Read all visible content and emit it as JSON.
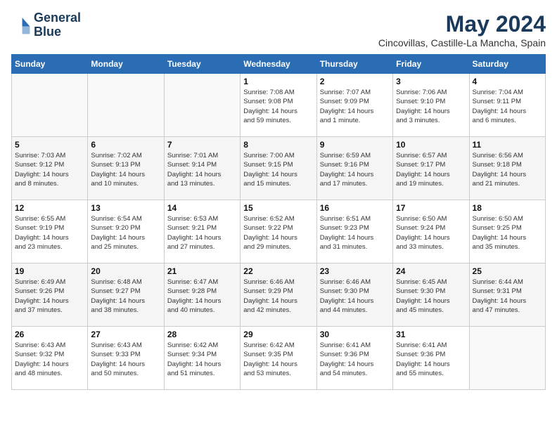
{
  "logo": {
    "line1": "General",
    "line2": "Blue"
  },
  "title": "May 2024",
  "location": "Cincovillas, Castille-La Mancha, Spain",
  "days_of_week": [
    "Sunday",
    "Monday",
    "Tuesday",
    "Wednesday",
    "Thursday",
    "Friday",
    "Saturday"
  ],
  "weeks": [
    [
      {
        "day": "",
        "info": ""
      },
      {
        "day": "",
        "info": ""
      },
      {
        "day": "",
        "info": ""
      },
      {
        "day": "1",
        "info": "Sunrise: 7:08 AM\nSunset: 9:08 PM\nDaylight: 14 hours\nand 59 minutes."
      },
      {
        "day": "2",
        "info": "Sunrise: 7:07 AM\nSunset: 9:09 PM\nDaylight: 14 hours\nand 1 minute."
      },
      {
        "day": "3",
        "info": "Sunrise: 7:06 AM\nSunset: 9:10 PM\nDaylight: 14 hours\nand 3 minutes."
      },
      {
        "day": "4",
        "info": "Sunrise: 7:04 AM\nSunset: 9:11 PM\nDaylight: 14 hours\nand 6 minutes."
      }
    ],
    [
      {
        "day": "5",
        "info": "Sunrise: 7:03 AM\nSunset: 9:12 PM\nDaylight: 14 hours\nand 8 minutes."
      },
      {
        "day": "6",
        "info": "Sunrise: 7:02 AM\nSunset: 9:13 PM\nDaylight: 14 hours\nand 10 minutes."
      },
      {
        "day": "7",
        "info": "Sunrise: 7:01 AM\nSunset: 9:14 PM\nDaylight: 14 hours\nand 13 minutes."
      },
      {
        "day": "8",
        "info": "Sunrise: 7:00 AM\nSunset: 9:15 PM\nDaylight: 14 hours\nand 15 minutes."
      },
      {
        "day": "9",
        "info": "Sunrise: 6:59 AM\nSunset: 9:16 PM\nDaylight: 14 hours\nand 17 minutes."
      },
      {
        "day": "10",
        "info": "Sunrise: 6:57 AM\nSunset: 9:17 PM\nDaylight: 14 hours\nand 19 minutes."
      },
      {
        "day": "11",
        "info": "Sunrise: 6:56 AM\nSunset: 9:18 PM\nDaylight: 14 hours\nand 21 minutes."
      }
    ],
    [
      {
        "day": "12",
        "info": "Sunrise: 6:55 AM\nSunset: 9:19 PM\nDaylight: 14 hours\nand 23 minutes."
      },
      {
        "day": "13",
        "info": "Sunrise: 6:54 AM\nSunset: 9:20 PM\nDaylight: 14 hours\nand 25 minutes."
      },
      {
        "day": "14",
        "info": "Sunrise: 6:53 AM\nSunset: 9:21 PM\nDaylight: 14 hours\nand 27 minutes."
      },
      {
        "day": "15",
        "info": "Sunrise: 6:52 AM\nSunset: 9:22 PM\nDaylight: 14 hours\nand 29 minutes."
      },
      {
        "day": "16",
        "info": "Sunrise: 6:51 AM\nSunset: 9:23 PM\nDaylight: 14 hours\nand 31 minutes."
      },
      {
        "day": "17",
        "info": "Sunrise: 6:50 AM\nSunset: 9:24 PM\nDaylight: 14 hours\nand 33 minutes."
      },
      {
        "day": "18",
        "info": "Sunrise: 6:50 AM\nSunset: 9:25 PM\nDaylight: 14 hours\nand 35 minutes."
      }
    ],
    [
      {
        "day": "19",
        "info": "Sunrise: 6:49 AM\nSunset: 9:26 PM\nDaylight: 14 hours\nand 37 minutes."
      },
      {
        "day": "20",
        "info": "Sunrise: 6:48 AM\nSunset: 9:27 PM\nDaylight: 14 hours\nand 38 minutes."
      },
      {
        "day": "21",
        "info": "Sunrise: 6:47 AM\nSunset: 9:28 PM\nDaylight: 14 hours\nand 40 minutes."
      },
      {
        "day": "22",
        "info": "Sunrise: 6:46 AM\nSunset: 9:29 PM\nDaylight: 14 hours\nand 42 minutes."
      },
      {
        "day": "23",
        "info": "Sunrise: 6:46 AM\nSunset: 9:30 PM\nDaylight: 14 hours\nand 44 minutes."
      },
      {
        "day": "24",
        "info": "Sunrise: 6:45 AM\nSunset: 9:30 PM\nDaylight: 14 hours\nand 45 minutes."
      },
      {
        "day": "25",
        "info": "Sunrise: 6:44 AM\nSunset: 9:31 PM\nDaylight: 14 hours\nand 47 minutes."
      }
    ],
    [
      {
        "day": "26",
        "info": "Sunrise: 6:43 AM\nSunset: 9:32 PM\nDaylight: 14 hours\nand 48 minutes."
      },
      {
        "day": "27",
        "info": "Sunrise: 6:43 AM\nSunset: 9:33 PM\nDaylight: 14 hours\nand 50 minutes."
      },
      {
        "day": "28",
        "info": "Sunrise: 6:42 AM\nSunset: 9:34 PM\nDaylight: 14 hours\nand 51 minutes."
      },
      {
        "day": "29",
        "info": "Sunrise: 6:42 AM\nSunset: 9:35 PM\nDaylight: 14 hours\nand 53 minutes."
      },
      {
        "day": "30",
        "info": "Sunrise: 6:41 AM\nSunset: 9:36 PM\nDaylight: 14 hours\nand 54 minutes."
      },
      {
        "day": "31",
        "info": "Sunrise: 6:41 AM\nSunset: 9:36 PM\nDaylight: 14 hours\nand 55 minutes."
      },
      {
        "day": "",
        "info": ""
      }
    ]
  ]
}
